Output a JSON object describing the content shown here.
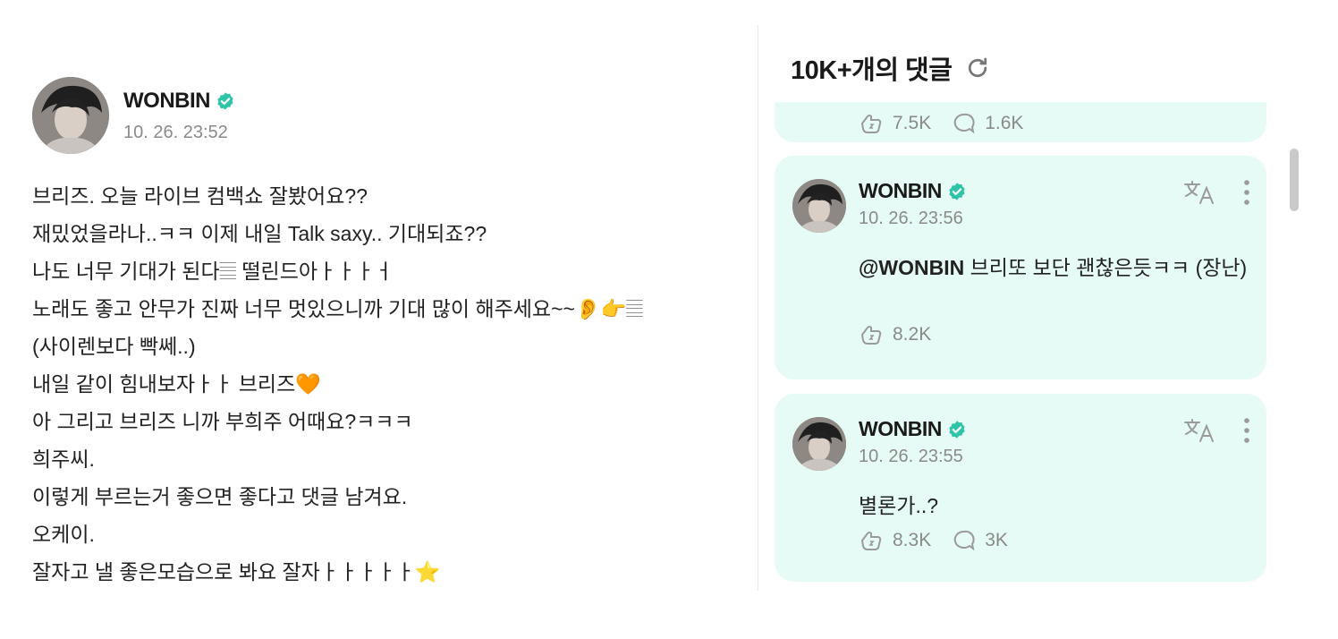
{
  "post": {
    "author": "WONBIN",
    "timestamp": "10. 26. 23:52",
    "lines": [
      "브리즈. 오늘 라이브 컴백쇼 잘봤어요??",
      "재밌었을라나..ㅋㅋ 이제 내일 Talk saxy.. 기대되죠??",
      "나도 너무 기대가 된다𝄚 떨린드아ㅏㅏㅏㅓ",
      "노래도 좋고 안무가 진짜 너무 멋있으니까 기대 많이 해주세요~~👂👉𝄚",
      "(사이렌보다 빡쎄..)",
      "내일 같이 힘내보자ㅏㅏ 브리즈🧡",
      "아 그리고 브리즈 니까 부희주 어때요?ㅋㅋㅋ",
      "희주씨.",
      "이렇게 부르는거 좋으면 좋다고 댓글 남겨요.",
      "오케이.",
      "잘자고 낼 좋은모습으로 봐요 잘자ㅏㅏㅏㅏㅏ⭐"
    ]
  },
  "comments_panel": {
    "title": "10K+개의 댓글",
    "partial_comment": {
      "likes": "7.5K",
      "replies": "1.6K"
    },
    "comments": [
      {
        "author": "WONBIN",
        "timestamp": "10. 26. 23:56",
        "mention": "@WONBIN",
        "text": " 브리또 보단 괜찮은듯ㅋㅋ (장난)",
        "likes": "8.2K"
      },
      {
        "author": "WONBIN",
        "timestamp": "10. 26. 23:55",
        "text": "별론가..?",
        "likes": "8.3K",
        "replies": "3K"
      }
    ]
  },
  "icons": {
    "verified": "verified-badge-icon",
    "refresh": "refresh-icon",
    "translate": "translate-icon",
    "more": "more-vertical-icon",
    "like": "like-icon",
    "reply": "reply-bubble-icon"
  },
  "colors": {
    "card_bg": "#e6fbf5",
    "verified": "#2ec4a7",
    "muted_text": "#8a8a8a"
  }
}
